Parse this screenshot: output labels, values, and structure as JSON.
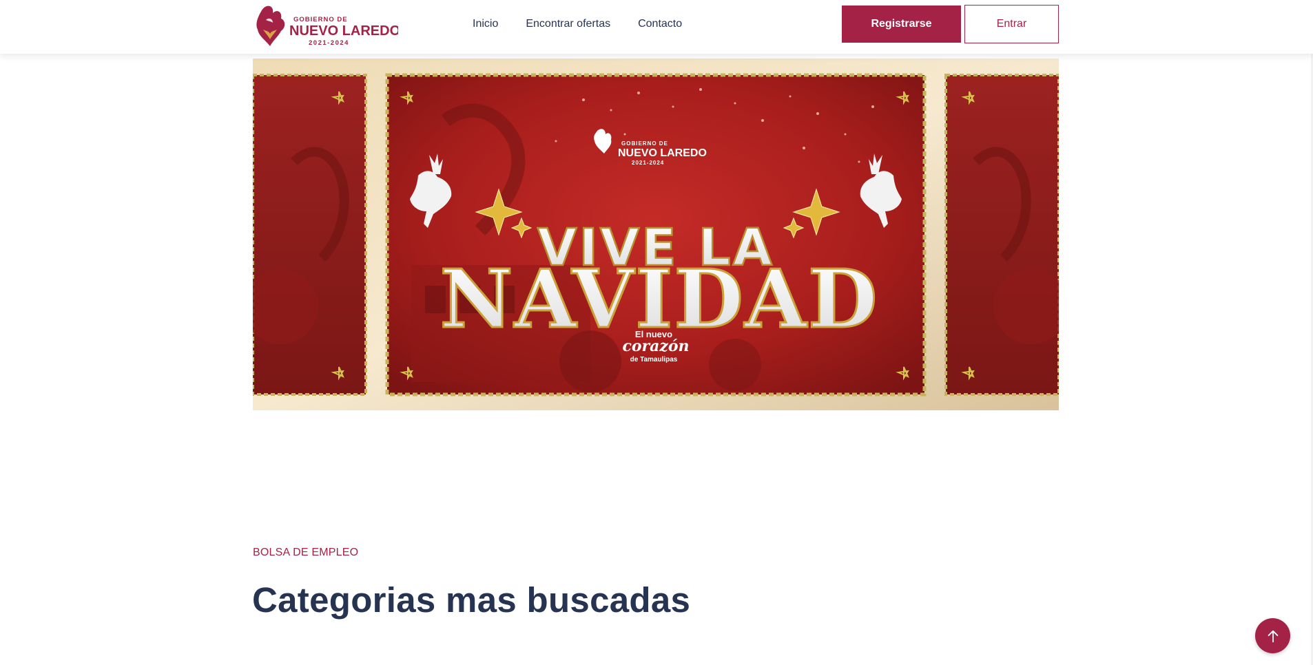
{
  "header": {
    "logo": {
      "line1": "GOBIERNO DE",
      "line2": "NUEVO LAREDO",
      "line3": "2021-2024",
      "icon": "heart-flame-icon"
    },
    "nav": [
      {
        "label": "Inicio"
      },
      {
        "label": "Encontrar ofertas"
      },
      {
        "label": "Contacto"
      }
    ],
    "register_label": "Registrarse",
    "login_label": "Entrar"
  },
  "banner": {
    "logo_line1": "GOBIERNO DE",
    "logo_line2": "NUEVO LAREDO",
    "logo_line3": "2021-2024",
    "headline_top": "VIVE LA",
    "headline_main": "NAVIDAD",
    "tag_line1": "El nuevo",
    "tag_line2": "corazón",
    "tag_line3": "de Tamaulipas"
  },
  "section": {
    "eyebrow": "BOLSA DE EMPLEO",
    "title": "Categorias mas buscadas"
  },
  "colors": {
    "brand": "#a32246",
    "text": "#263452",
    "banner_red": "#b3201f",
    "banner_gold": "#d4b15a"
  },
  "scroll_top_icon": "arrow-up-icon"
}
